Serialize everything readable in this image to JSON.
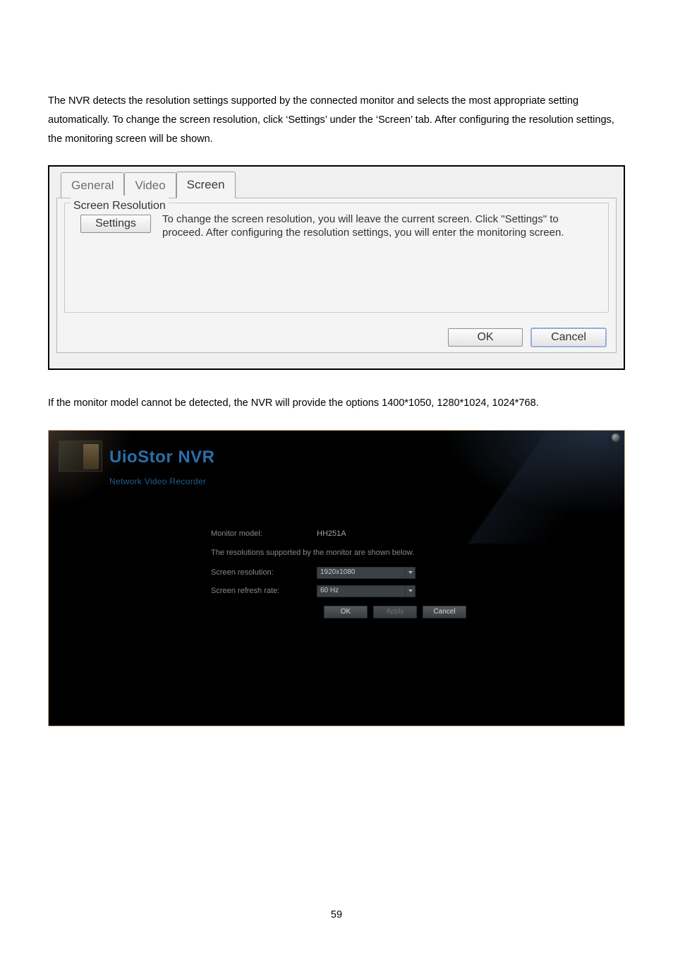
{
  "para1": "The NVR detects the resolution settings supported by the connected monitor and selects the most appropriate setting automatically.   To change the screen resolution, click ‘Settings’ under the ‘Screen’ tab.    After configuring the resolution settings, the monitoring screen will be shown.",
  "para2": "If the monitor model cannot be detected, the NVR will provide the options 1400*1050, 1280*1024, 1024*768.",
  "dlg1": {
    "tabs": {
      "general": "General",
      "video": "Video",
      "screen": "Screen"
    },
    "groupbox_title": "Screen Resolution",
    "settings_btn": "Settings",
    "group_text": "To change the screen resolution, you will leave the current screen. Click \"Settings\" to proceed. After configuring the resolution settings, you will enter the monitoring screen.",
    "ok": "OK",
    "cancel": "Cancel"
  },
  "dlg2": {
    "brand_title": "UioStor NVR",
    "brand_sub": "Network Video Recorder",
    "monitor_model_label": "Monitor model:",
    "monitor_model_value": "HH251A",
    "note": "The resolutions supported by the monitor are shown below.",
    "resolution_label": "Screen resolution:",
    "resolution_value": "1920x1080",
    "refresh_label": "Screen refresh rate:",
    "refresh_value": "60 Hz",
    "ok": "OK",
    "apply": "Apply",
    "cancel": "Cancel"
  },
  "page_number": "59"
}
